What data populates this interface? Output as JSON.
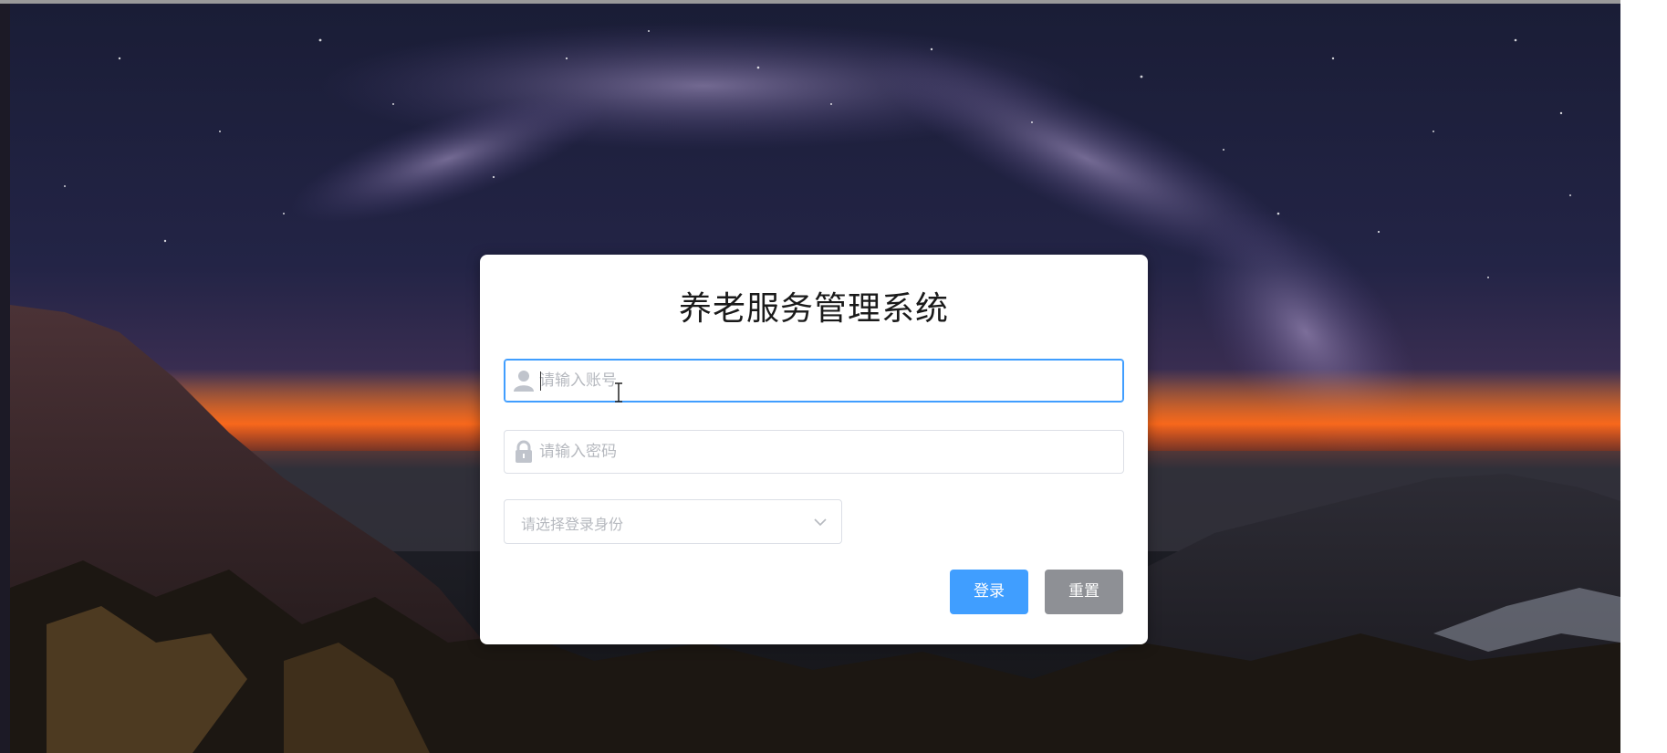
{
  "app": {
    "title": "养老服务管理系统"
  },
  "login_form": {
    "username": {
      "placeholder": "请输入账号",
      "value": "",
      "icon": "user-icon"
    },
    "password": {
      "placeholder": "请输入密码",
      "value": "",
      "icon": "lock-icon"
    },
    "role_select": {
      "placeholder": "请选择登录身份",
      "icon": "chevron-down-icon"
    },
    "login_button": "登录",
    "reset_button": "重置"
  },
  "colors": {
    "primary": "#409eff",
    "reset_button": "#8e9095",
    "focus_border": "#409eff",
    "placeholder_text": "#b6b9bf"
  }
}
